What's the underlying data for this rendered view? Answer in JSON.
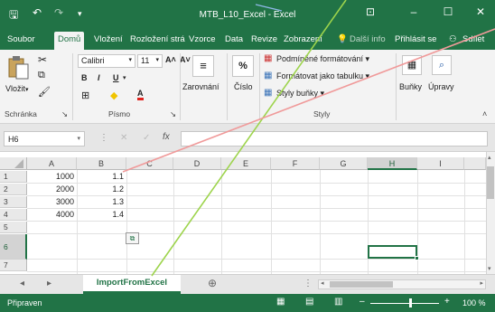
{
  "window": {
    "title": "MTB_L10_Excel - Excel",
    "qa_save": "🖫",
    "qa_undo": "↶",
    "qa_redo": "↷",
    "qa_more": "▾",
    "ctrl_ribbon": "⊡",
    "ctrl_min": "‒",
    "ctrl_max": "☐",
    "ctrl_close": "✕"
  },
  "tabs": {
    "items": [
      "Soubor",
      "Domů",
      "Vložení",
      "Rozložení strá",
      "Vzorce",
      "Data",
      "Revize",
      "Zobrazení",
      "Další info",
      "Přihlásit se",
      "Sdílet"
    ],
    "active_index": 1,
    "tell_icon": "💡",
    "share_icon": "⚇"
  },
  "ribbon": {
    "paste": "Vložit",
    "clipboard_group": "Schránka",
    "font_name": "Calibri",
    "font_size": "11",
    "bold": "B",
    "italic": "I",
    "underline": "U",
    "font_grow": "A˄",
    "font_shrink": "A˅",
    "font_color": "A",
    "font_group": "Písmo",
    "alignment": "Zarovnání",
    "number": "Číslo",
    "number_sign": "%",
    "cond_format": "Podmíněné formátování ▾",
    "format_table": "Formátovat jako tabulku ▾",
    "cell_styles": "Styly buňky ▾",
    "styles_group": "Styly",
    "cells": "Buňky",
    "editing": "Úpravy",
    "launcher": "↘",
    "collapse": "˄"
  },
  "formula_bar": {
    "name_box": "H6",
    "cancel": "✕",
    "enter": "✓",
    "fx": "fx",
    "value": ""
  },
  "grid": {
    "columns": [
      "A",
      "B",
      "C",
      "D",
      "E",
      "F",
      "G",
      "H",
      "I"
    ],
    "rows": [
      "1",
      "2",
      "3",
      "4",
      "5",
      "6",
      "7"
    ],
    "selected_column": "H",
    "selected_row": "6",
    "data": [
      [
        "1000",
        "1.1"
      ],
      [
        "2000",
        "1.2"
      ],
      [
        "3000",
        "1.3"
      ],
      [
        "4000",
        "1.4"
      ]
    ]
  },
  "sheets": {
    "active": "ImportFromExcel",
    "add": "⊕",
    "prev": "◂",
    "next": "▸"
  },
  "status": {
    "ready": "Připraven",
    "zoom": "100 %",
    "zoom_minus": "–",
    "zoom_plus": "+"
  }
}
